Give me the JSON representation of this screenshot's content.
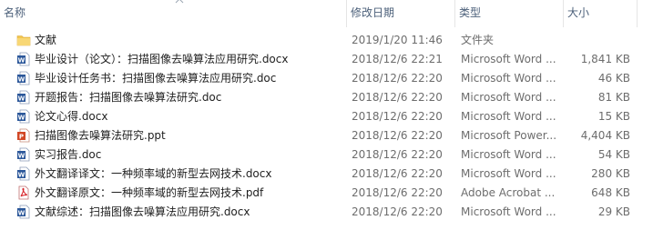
{
  "columns": {
    "name": "名称",
    "date": "修改日期",
    "type": "类型",
    "size": "大小"
  },
  "files": [
    {
      "icon": "folder-icon",
      "name": "文献",
      "date": "2019/1/20 11:46",
      "type": "文件夹",
      "size": ""
    },
    {
      "icon": "word-doc-icon",
      "name": "毕业设计（论文）：扫描图像去噪算法应用研究.docx",
      "date": "2018/12/6 22:21",
      "type": "Microsoft Word ...",
      "size": "1,841 KB"
    },
    {
      "icon": "word-doc-icon",
      "name": "毕业设计任务书：扫描图像去噪算法应用研究.doc",
      "date": "2018/12/6 22:20",
      "type": "Microsoft Word ...",
      "size": "46 KB"
    },
    {
      "icon": "word-doc-icon",
      "name": "开题报告：扫描图像去噪算法研究.doc",
      "date": "2018/12/6 22:20",
      "type": "Microsoft Word ...",
      "size": "81 KB"
    },
    {
      "icon": "word-doc-icon",
      "name": "论文心得.docx",
      "date": "2018/12/6 22:20",
      "type": "Microsoft Word ...",
      "size": "15 KB"
    },
    {
      "icon": "powerpoint-icon",
      "name": "扫描图像去噪算法研究.ppt",
      "date": "2018/12/6 22:20",
      "type": "Microsoft Power...",
      "size": "4,404 KB"
    },
    {
      "icon": "word-doc-icon",
      "name": "实习报告.doc",
      "date": "2018/12/6 22:20",
      "type": "Microsoft Word ...",
      "size": "54 KB"
    },
    {
      "icon": "word-doc-icon",
      "name": "外文翻译译文：一种频率域的新型去网技术.docx",
      "date": "2018/12/6 22:20",
      "type": "Microsoft Word ...",
      "size": "280 KB"
    },
    {
      "icon": "pdf-icon",
      "name": "外文翻译原文：一种频率域的新型去网技术.pdf",
      "date": "2018/12/6 22:20",
      "type": "Adobe Acrobat ...",
      "size": "648 KB"
    },
    {
      "icon": "word-doc-icon",
      "name": "文献综述：扫描图像去噪算法应用研究.docx",
      "date": "2018/12/6 22:20",
      "type": "Microsoft Word ...",
      "size": "29 KB"
    }
  ],
  "colors": {
    "header_text": "#4c607a",
    "meta_text": "#6d6d6d",
    "folder": "#f3c64f",
    "word": "#2b579a",
    "powerpoint": "#d24726",
    "pdf": "#d8232a"
  }
}
